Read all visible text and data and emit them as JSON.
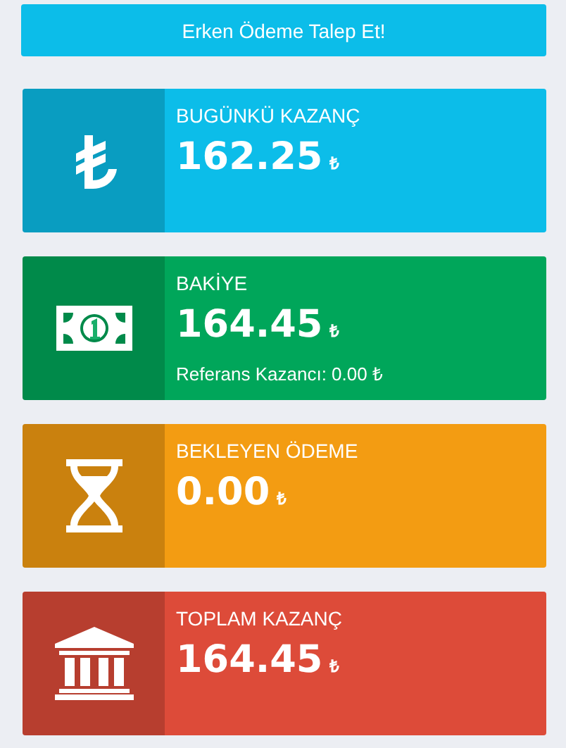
{
  "request_button": {
    "label": "Erken Ödeme Talep Et!"
  },
  "cards": [
    {
      "kind": "lira",
      "color": "#0cbde9",
      "title": "BUGÜNKÜ KAZANÇ",
      "value": "162.25",
      "unit": "₺"
    },
    {
      "kind": "banknote",
      "color": "#00a65a",
      "title": "BAKİYE",
      "value": "164.45",
      "unit": "₺",
      "note": "Referans Kazancı: 0.00 ₺"
    },
    {
      "kind": "hourglass",
      "color": "#f39c12",
      "title": "BEKLEYEN ÖDEME",
      "value": "0.00",
      "unit": "₺"
    },
    {
      "kind": "bank",
      "color": "#dd4b39",
      "title": "TOPLAM KAZANÇ",
      "value": "164.45",
      "unit": "₺"
    }
  ]
}
